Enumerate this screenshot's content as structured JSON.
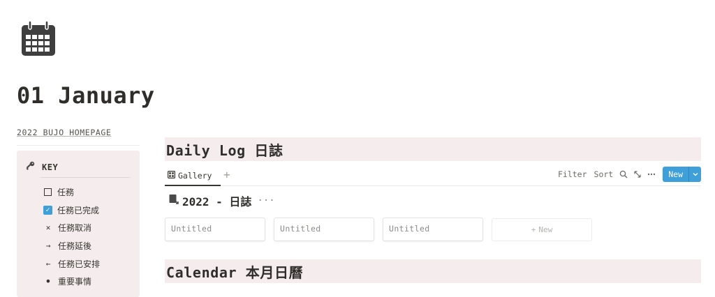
{
  "page": {
    "icon": "calendar-icon",
    "title": "01 January",
    "breadcrumb": "2022 BUJO HOMEPAGE"
  },
  "key_box": {
    "icon": "key-icon",
    "title": "KEY",
    "items": [
      {
        "icon": "checkbox-empty",
        "label": "任務"
      },
      {
        "icon": "checkbox-checked",
        "label": "任務已完成"
      },
      {
        "icon": "x-mark",
        "symbol": "✕",
        "label": "任務取消"
      },
      {
        "icon": "arrow-right",
        "symbol": "→",
        "label": "任務延後"
      },
      {
        "icon": "arrow-left",
        "symbol": "←",
        "label": "任務已安排"
      },
      {
        "icon": "bullet",
        "symbol": "•",
        "label": "重要事情"
      }
    ]
  },
  "daily_log": {
    "heading": "Daily Log 日誌",
    "view_tab": "Gallery",
    "add_view": "+",
    "toolbar": {
      "filter": "Filter",
      "sort": "Sort",
      "new": "New"
    },
    "group": {
      "title": "2022 - 日誌",
      "more": "···"
    },
    "cards": [
      "Untitled",
      "Untitled",
      "Untitled"
    ],
    "new_card": "New",
    "new_card_plus": "+"
  },
  "calendar": {
    "heading": "Calendar 本月日曆"
  },
  "colors": {
    "accent": "#3f9fd8",
    "heading_bg": "#f5eded",
    "text": "#37352f"
  }
}
